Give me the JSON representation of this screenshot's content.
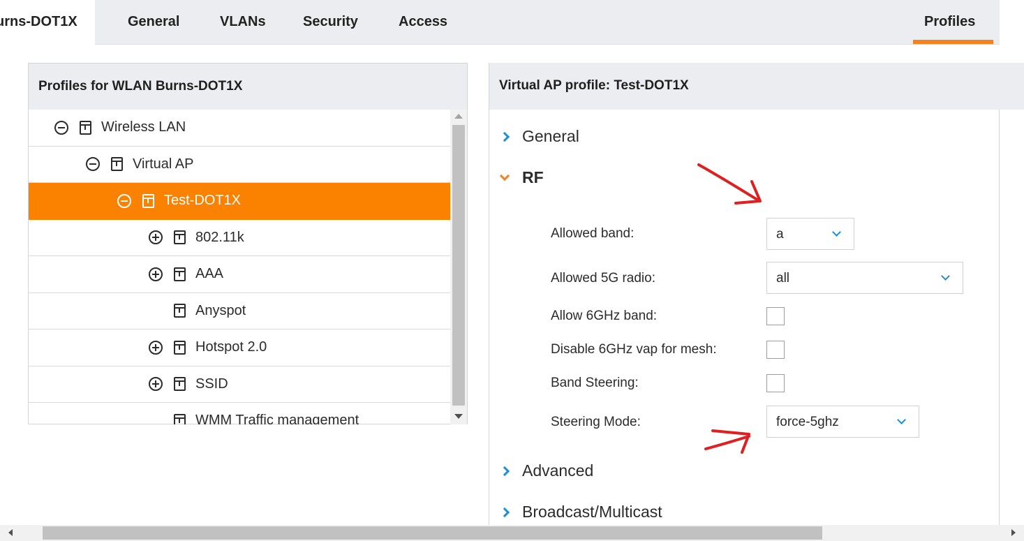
{
  "tabs": {
    "wlan": "urns-DOT1X",
    "general": "General",
    "vlans": "VLANs",
    "security": "Security",
    "access": "Access",
    "profiles": "Profiles"
  },
  "left_panel": {
    "title": "Profiles for WLAN Burns-DOT1X",
    "tree": [
      {
        "label": "Wireless LAN",
        "toggle": "collapse",
        "level": 0
      },
      {
        "label": "Virtual AP",
        "toggle": "collapse",
        "level": 1
      },
      {
        "label": "Test-DOT1X",
        "toggle": "collapse",
        "level": 2,
        "selected": true
      },
      {
        "label": "802.11k",
        "toggle": "expand",
        "level": 3
      },
      {
        "label": "AAA",
        "toggle": "expand",
        "level": 3
      },
      {
        "label": "Anyspot",
        "toggle": "none",
        "level": 3
      },
      {
        "label": "Hotspot 2.0",
        "toggle": "expand",
        "level": 3
      },
      {
        "label": "SSID",
        "toggle": "expand",
        "level": 3
      },
      {
        "label": "WMM Traffic management",
        "toggle": "none",
        "level": 3
      }
    ]
  },
  "right_panel": {
    "title": "Virtual AP profile: Test-DOT1X",
    "sections": {
      "general": "General",
      "rf": "RF",
      "advanced": "Advanced",
      "broadcast": "Broadcast/Multicast"
    },
    "rf_fields": {
      "allowed_band_label": "Allowed band:",
      "allowed_band_value": "a",
      "allowed_5g_label": "Allowed 5G radio:",
      "allowed_5g_value": "all",
      "allow_6ghz_label": "Allow 6GHz band:",
      "allow_6ghz_checked": false,
      "disable_6ghz_mesh_label": "Disable 6GHz vap for mesh:",
      "disable_6ghz_mesh_checked": false,
      "band_steering_label": "Band Steering:",
      "band_steering_checked": false,
      "steering_mode_label": "Steering Mode:",
      "steering_mode_value": "force-5ghz"
    }
  },
  "colors": {
    "accent": "#f5821f",
    "selected_row": "#fb8200",
    "chevron": "#1a8fd8",
    "annotation": "#e02020"
  }
}
